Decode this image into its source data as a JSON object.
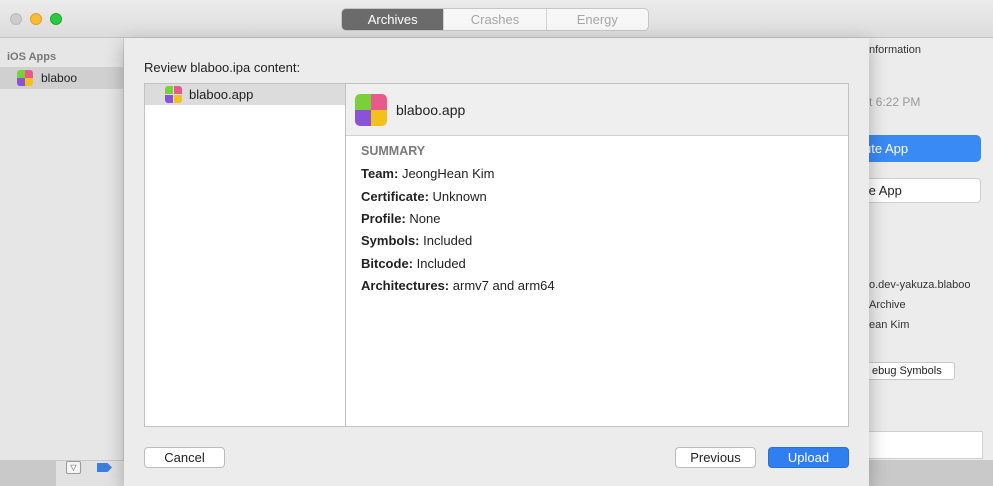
{
  "toolbar": {
    "tabs": [
      {
        "label": "Archives",
        "active": true
      },
      {
        "label": "Crashes",
        "active": false
      },
      {
        "label": "Energy",
        "active": false
      }
    ]
  },
  "sidebar": {
    "header": "iOS Apps",
    "items": [
      {
        "label": "blaboo",
        "icon": "app-icon"
      }
    ]
  },
  "inspector": {
    "tab_label": "nformation",
    "date": "t 6:22 PM",
    "primary_button": "ute App",
    "secondary_button": "te App",
    "identifier": "o.dev-yakuza.blaboo",
    "type": "Archive",
    "team": "ean Kim",
    "debug_symbols_button": "ebug Symbols"
  },
  "sheet": {
    "title": "Review blaboo.ipa content:",
    "list": [
      {
        "label": "blaboo.app",
        "selected": true
      }
    ],
    "detail_header": "blaboo.app",
    "summary_title": "SUMMARY",
    "summary": [
      {
        "key": "Team:",
        "value": "JeongHean Kim"
      },
      {
        "key": "Certificate:",
        "value": "Unknown"
      },
      {
        "key": "Profile:",
        "value": "None"
      },
      {
        "key": "Symbols:",
        "value": "Included"
      },
      {
        "key": "Bitcode:",
        "value": "Included"
      },
      {
        "key": "Architectures:",
        "value": "armv7 and arm64"
      }
    ],
    "buttons": {
      "cancel": "Cancel",
      "previous": "Previous",
      "upload": "Upload"
    }
  },
  "colors": {
    "accent": "#2f7ff0",
    "segment_active": "#6b6b6b",
    "icon_tiles": [
      "#f2c21b",
      "#e85a8a",
      "#7a52d6",
      "#2ab6e8"
    ]
  }
}
